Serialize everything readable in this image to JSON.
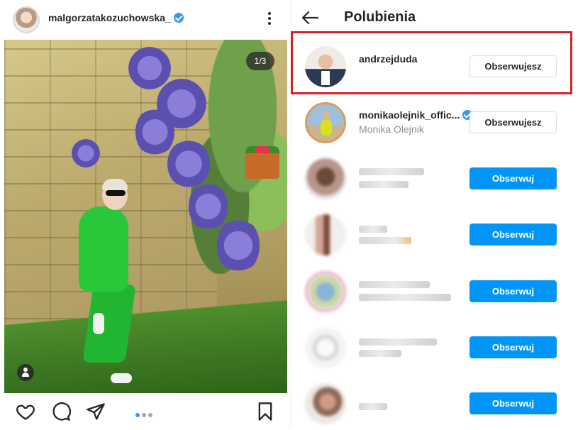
{
  "post": {
    "username": "malgorzatakozuchowska_",
    "verified": true,
    "page_indicator": "1/3",
    "carousel_count": 3,
    "carousel_active": 1
  },
  "icons": {
    "more": "more-vertical-icon",
    "like": "heart-icon",
    "comment": "comment-icon",
    "share": "send-icon",
    "save": "bookmark-icon",
    "back": "back-arrow-icon",
    "user_tag": "user-tag-icon"
  },
  "likes": {
    "title": "Polubienia",
    "highlighted_user": "andrzejduda",
    "highlight_color": "#d2232a",
    "users": [
      {
        "username": "andrzejduda",
        "full_name": "",
        "button": "Obserwujesz",
        "state": "following",
        "blurred": false
      },
      {
        "username": "monikaolejnik_offic...",
        "full_name": "Monika Olejnik",
        "button": "Obserwujesz",
        "state": "following",
        "blurred": false,
        "verified": true
      },
      {
        "username": "",
        "full_name": "",
        "button": "Obserwuj",
        "state": "follow",
        "blurred": true
      },
      {
        "username": "",
        "full_name": "",
        "button": "Obserwuj",
        "state": "follow",
        "blurred": true
      },
      {
        "username": "",
        "full_name": "",
        "button": "Obserwuj",
        "state": "follow",
        "blurred": true
      },
      {
        "username": "",
        "full_name": "",
        "button": "Obserwuj",
        "state": "follow",
        "blurred": true
      },
      {
        "username": "",
        "full_name": "",
        "button": "Obserwuj",
        "state": "follow",
        "blurred": true
      }
    ]
  },
  "colors": {
    "follow_button": "#0095f6",
    "verified_badge": "#3897f0",
    "text_primary": "#262626",
    "text_secondary": "#8e8e8e"
  }
}
